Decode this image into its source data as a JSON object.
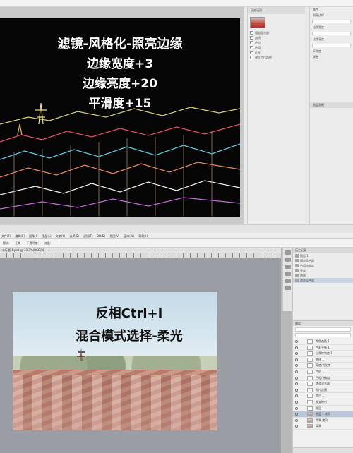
{
  "top_screenshot": {
    "overlay_lines": [
      "滤镜-风格化-照亮边缘",
      "边缘宽度+3",
      "边缘亮度+20",
      "平滑度+15"
    ],
    "history_panel": {
      "title": "历史记录",
      "items": [
        "通道混合器",
        "曲线",
        "色阶",
        "色相",
        "打开",
        "建立工作路径"
      ]
    },
    "properties_panel": {
      "rows": [
        "属性",
        "照亮边缘",
        "边缘宽度",
        "边缘亮度",
        "平滑度",
        "调整"
      ],
      "tab": "图层面板"
    }
  },
  "bottom_screenshot": {
    "menu": [
      "文件(F)",
      "编辑(E)",
      "图像(I)",
      "图层(L)",
      "文字(Y)",
      "选择(S)",
      "滤镜(T)",
      "3D(D)",
      "视图(V)",
      "窗口(W)",
      "帮助(H)"
    ],
    "options": [
      "模式:",
      "正常",
      "不透明度:",
      "流量:"
    ],
    "doc_tab": "未标题-1.psd @ 33.3%(RGB/8)",
    "overlay_lines": [
      "反相Ctrl+I",
      "混合模式选择-柔光"
    ],
    "panel_top": {
      "head": "历史记录",
      "items": [
        "图层 1",
        "通道混合器",
        "色相饱和度",
        "亮度",
        "曲线",
        "通道混合器"
      ]
    },
    "layers": {
      "tab": "图层",
      "rows": [
        "颜色查找 1",
        "色彩平衡 1",
        "自然饱和度 1",
        "曲线 1",
        "亮度/对比度",
        "色阶 1",
        "色相/饱和度",
        "通道混合器",
        "照片滤镜",
        "黑白 1",
        "渐变映射",
        "图层 1",
        "图层 1 拷贝",
        "背景 拷贝",
        "背景"
      ]
    }
  }
}
